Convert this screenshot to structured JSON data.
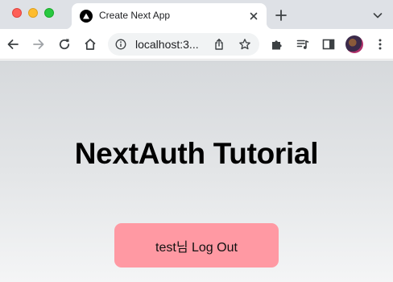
{
  "browser": {
    "tab": {
      "title": "Create Next App",
      "favicon": "triangle-icon"
    },
    "address": {
      "url": "localhost:3..."
    },
    "colors": {
      "tab_strip": "#dee1e6",
      "omnibox": "#f1f3f4"
    }
  },
  "page": {
    "heading": "NextAuth Tutorial",
    "logout_button": "test님 Log Out",
    "colors": {
      "button": "#ff99a3"
    }
  }
}
